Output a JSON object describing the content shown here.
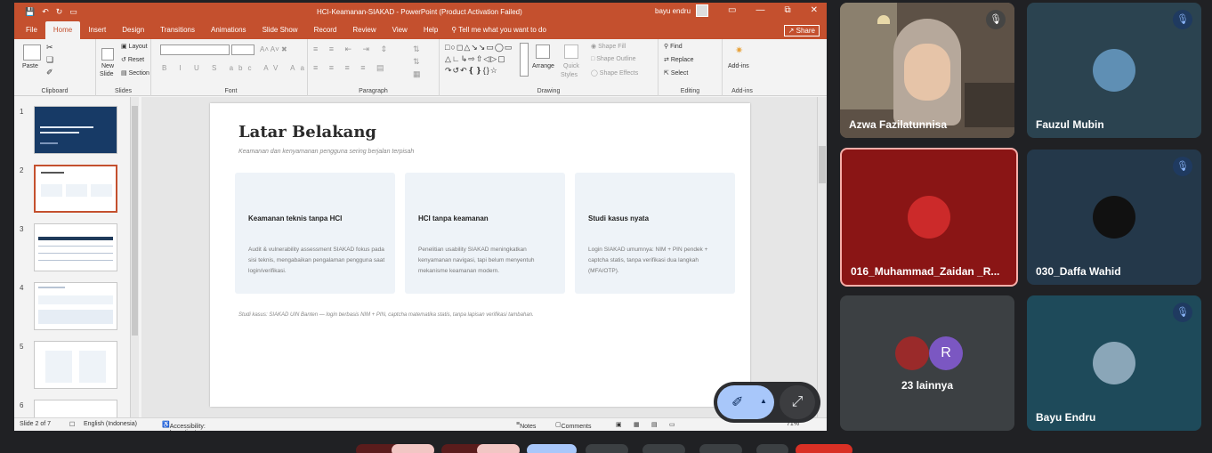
{
  "powerpoint": {
    "window_title": "HCI-Keamanan-SIAKAD  -  PowerPoint (Product Activation Failed)",
    "user": "bayu endru",
    "share": "Share",
    "tabs": [
      "File",
      "Home",
      "Insert",
      "Design",
      "Transitions",
      "Animations",
      "Slide Show",
      "Record",
      "Review",
      "View",
      "Help"
    ],
    "tell_me": "Tell me what you want to do",
    "ribbon": {
      "clipboard": {
        "label": "Clipboard",
        "paste": "Paste"
      },
      "slides": {
        "label": "Slides",
        "new_slide": "New",
        "new_slide2": "Slide",
        "layout": "Layout",
        "reset": "Reset",
        "section": "Section"
      },
      "font": {
        "label": "Font"
      },
      "paragraph": {
        "label": "Paragraph"
      },
      "drawing": {
        "label": "Drawing",
        "arrange": "Arrange",
        "quick_styles": "Quick",
        "quick_styles2": "Styles",
        "shape_fill": "Shape Fill",
        "shape_outline": "Shape Outline",
        "shape_effects": "Shape Effects"
      },
      "editing": {
        "label": "Editing",
        "find": "Find",
        "replace": "Replace",
        "select": "Select"
      },
      "addins": {
        "label": "Add-ins",
        "button": "Add-ins"
      }
    },
    "thumbnails": [
      "1",
      "2",
      "3",
      "4",
      "5",
      "6"
    ],
    "slide": {
      "title": "Latar Belakang",
      "subtitle": "Keamanan dan kenyamanan pengguna sering berjalan terpisah",
      "cards": [
        {
          "title": "Keamanan teknis tanpa HCI",
          "body": "Audit & vulnerability assessment SIAKAD fokus pada sisi teknis, mengabaikan pengalaman pengguna saat login/verifikasi."
        },
        {
          "title": "HCI tanpa keamanan",
          "body": "Penelitian usability SIAKAD meningkatkan kenyamanan navigasi, tapi belum menyentuh mekanisme keamanan modern."
        },
        {
          "title": "Studi kasus nyata",
          "body": "Login SIAKAD umumnya: NIM + PIN pendek + captcha statis, tanpa verifikasi dua langkah (MFA/OTP)."
        }
      ],
      "note": "Studi kasus: SIAKAD UIN Banten — login berbasis NIM + PIN, captcha matematika statis, tanpa lapisan verifikasi tambahan."
    },
    "status": {
      "slide_of": "Slide 2 of 7",
      "language": "English (Indonesia)",
      "accessibility": "Accessibility: Investigate",
      "notes": "Notes",
      "comments": "Comments",
      "zoom": "71%"
    }
  },
  "participants": [
    {
      "name": "Azwa Fazilatunnisa"
    },
    {
      "name": "Fauzul Mubin"
    },
    {
      "name": "016_Muhammad_Zaidan _R..."
    },
    {
      "name": "030_Daffa Wahid"
    },
    {
      "name": "23 lainnya",
      "avatar_letter": "R"
    },
    {
      "name": "Bayu Endru"
    }
  ],
  "colors": {
    "ppt_accent": "#c4502e",
    "meet_bg": "#202124",
    "speaking_border": "#f6aea9",
    "pen_button": "#a8c7fa"
  },
  "icons": {
    "muted": "mic-off-icon",
    "annotate": "pen-icon",
    "expand": "expand-icon"
  }
}
